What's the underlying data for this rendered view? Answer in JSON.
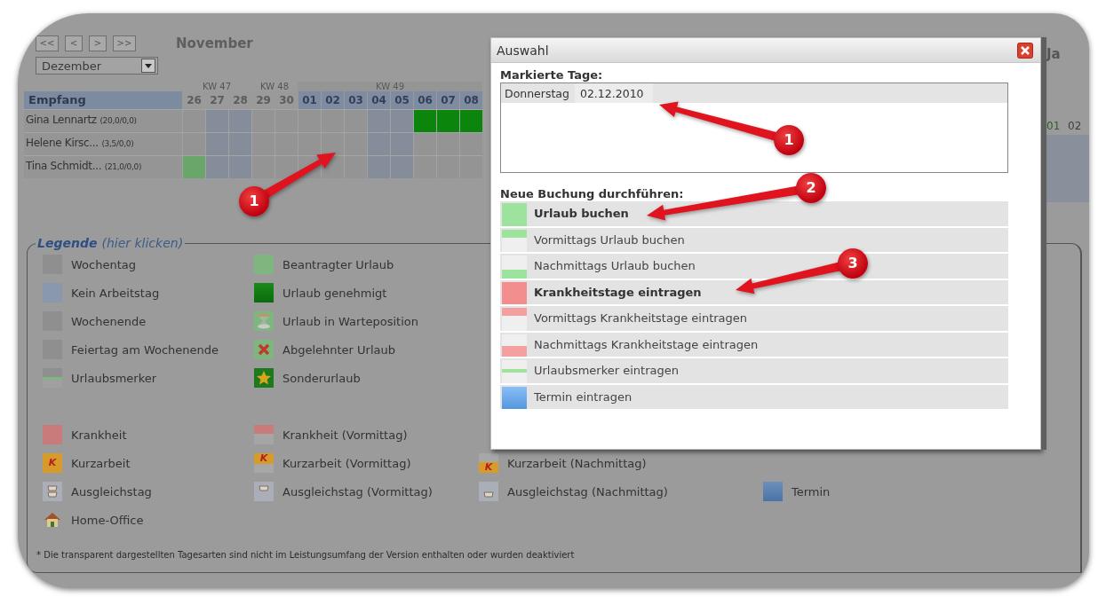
{
  "calendar": {
    "nav_buttons": [
      "<<",
      "<",
      ">",
      ">>"
    ],
    "month_heading": "November",
    "month_select": "Dezember",
    "right_month_heading": "Ja",
    "group": "Empfang",
    "weeks": [
      {
        "label": "KW 47",
        "other_month": true,
        "days": [
          "26",
          "27",
          "28"
        ]
      },
      {
        "label": "KW 48",
        "other_month": true,
        "days": [
          "29",
          "30"
        ]
      },
      {
        "label": "KW 49",
        "other_month": false,
        "days": [
          "01",
          "02",
          "03",
          "04",
          "05",
          "06",
          "07",
          "08"
        ]
      }
    ],
    "rows": [
      {
        "name": "Gina Lennartz",
        "balance": "(20,0/0,0)",
        "cells": [
          {
            "kind": "weekday"
          },
          {
            "kind": "free"
          },
          {
            "kind": "free"
          },
          {
            "kind": "weekday"
          },
          {
            "kind": "weekday"
          },
          {
            "kind": "weekday"
          },
          {
            "kind": "weekday"
          },
          {
            "kind": "weekday"
          },
          {
            "kind": "free"
          },
          {
            "kind": "free"
          },
          {
            "kind": "approved"
          },
          {
            "kind": "approved"
          },
          {
            "kind": "approved"
          }
        ]
      },
      {
        "name": "Helene Kirsc...",
        "balance": "(3,5/0,0)",
        "cells": [
          {
            "kind": "weekday"
          },
          {
            "kind": "free"
          },
          {
            "kind": "free"
          },
          {
            "kind": "weekday"
          },
          {
            "kind": "weekday"
          },
          {
            "kind": "weekday"
          },
          {
            "kind": "weekday"
          },
          {
            "kind": "weekday"
          },
          {
            "kind": "free"
          },
          {
            "kind": "free"
          },
          {
            "kind": "weekday"
          },
          {
            "kind": "weekday"
          },
          {
            "kind": "weekday"
          }
        ]
      },
      {
        "name": "Tina Schmidt...",
        "balance": "(21,0/0,0)",
        "cells": [
          {
            "kind": "requested"
          },
          {
            "kind": "free"
          },
          {
            "kind": "free"
          },
          {
            "kind": "weekday"
          },
          {
            "kind": "weekday"
          },
          {
            "kind": "weekday"
          },
          {
            "kind": "weekday"
          },
          {
            "kind": "weekday"
          },
          {
            "kind": "free"
          },
          {
            "kind": "free"
          },
          {
            "kind": "weekday"
          },
          {
            "kind": "weekday"
          },
          {
            "kind": "weekday"
          }
        ]
      }
    ],
    "right_days": [
      "01",
      "02"
    ]
  },
  "legend": {
    "title": "Legende",
    "hint": "(hier klicken)",
    "groups": [
      [
        [
          {
            "label": "Wochentag",
            "kind": "weekday"
          },
          {
            "label": "Beantragter Urlaub",
            "kind": "requested"
          }
        ],
        [
          {
            "label": "Kein Arbeitstag",
            "kind": "free"
          },
          {
            "label": "Urlaub genehmigt",
            "kind": "approved"
          }
        ],
        [
          {
            "label": "Wochenende",
            "kind": "weekend"
          },
          {
            "label": "Urlaub in Warteposition",
            "kind": "waiting"
          }
        ],
        [
          {
            "label": "Feiertag am Wochenende",
            "kind": "weekend"
          },
          {
            "label": "Abgelehnter Urlaub",
            "kind": "rejected"
          }
        ],
        [
          {
            "label": "Urlaubsmerker",
            "kind": "marker"
          },
          {
            "label": "Sonderurlaub",
            "kind": "special"
          }
        ]
      ],
      [
        [
          {
            "label": "Krankheit",
            "kind": "sick"
          },
          {
            "label": "Krankheit (Vormittag)",
            "kind": "sick_am"
          }
        ],
        [
          {
            "label": "Kurzarbeit",
            "kind": "short",
            "mark": "K"
          },
          {
            "label": "Kurzarbeit (Vormittag)",
            "kind": "short_am",
            "mark": "K"
          },
          {
            "label": "Kurzarbeit (Nachmittag)",
            "kind": "short_pm",
            "mark": "K"
          }
        ],
        [
          {
            "label": "Ausgleichstag",
            "kind": "comp"
          },
          {
            "label": "Ausgleichstag (Vormittag)",
            "kind": "comp_am"
          },
          {
            "label": "Ausgleichstag (Nachmittag)",
            "kind": "comp_pm"
          },
          {
            "label": "Termin",
            "kind": "appt"
          }
        ],
        [
          {
            "label": "Home-Office",
            "kind": "home"
          }
        ]
      ]
    ],
    "footnote": "* Die transparent dargestellten Tagesarten sind nicht im Leistungsumfang der Version enthalten oder wurden deaktiviert"
  },
  "dialog": {
    "title": "Auswahl",
    "marked_label": "Markierte Tage:",
    "marked_days": [
      {
        "weekday": "Donnerstag",
        "date": "02.12.2010"
      }
    ],
    "booking_label": "Neue Buchung durchführen:",
    "options": [
      {
        "label": "Urlaub buchen",
        "kind": "vac",
        "bold": true
      },
      {
        "label": "Vormittags Urlaub buchen",
        "kind": "vac_am",
        "bold": false
      },
      {
        "label": "Nachmittags Urlaub buchen",
        "kind": "vac_pm",
        "bold": false
      },
      {
        "label": "Krankheitstage eintragen",
        "kind": "sick",
        "bold": true
      },
      {
        "label": "Vormittags Krankheitstage eintragen",
        "kind": "sick_am",
        "bold": false
      },
      {
        "label": "Nachmittags Krankheitstage eintragen",
        "kind": "sick_pm",
        "bold": false
      },
      {
        "label": "Urlaubsmerker eintragen",
        "kind": "marker",
        "bold": false
      },
      {
        "label": "Termin eintragen",
        "kind": "appt",
        "bold": false
      }
    ]
  },
  "callouts": [
    {
      "number": "1"
    },
    {
      "number": "1"
    },
    {
      "number": "2"
    },
    {
      "number": "3"
    }
  ]
}
